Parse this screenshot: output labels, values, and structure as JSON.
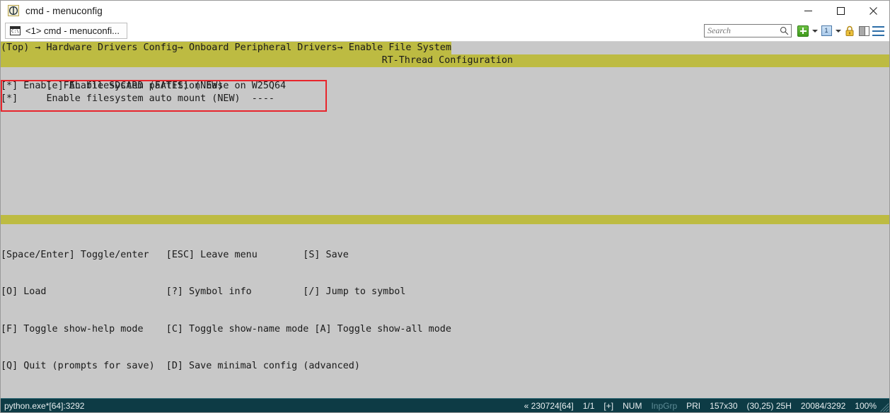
{
  "window": {
    "title": "cmd - menuconfig",
    "icon": "console-app-icon",
    "controls": {
      "minimize": "─",
      "maximize": "□",
      "close": "✕"
    }
  },
  "tabstrip": {
    "tab": {
      "label": "<1> cmd - menuconfi...",
      "icon_text": "C:\\."
    },
    "toolbar": {
      "search_placeholder": "Search",
      "search_value": "",
      "search_icon": "magnifier-icon",
      "new_tab_icon": "green-plus-icon",
      "new_tab_caret": "chevron-down-icon",
      "panel_icon_label": "1",
      "panel_caret": "chevron-down-icon",
      "lock_icon": "padlock-icon",
      "split_icon": "split-panel-icon",
      "menu_icon": "hamburger-menu-icon"
    }
  },
  "terminal": {
    "breadcrumb": "(Top) → Hardware Drivers Config→ Onboard Peripheral Drivers→ Enable File System",
    "config_title": "RT-Thread Configuration",
    "menu_items": [
      {
        "text": "[ ] Enable SDCARD (FATFS) (NEW)",
        "selected": true
      },
      {
        "text": "[*] Enable FAL filesystem partition base on W25Q64",
        "selected": false
      },
      {
        "text": "[*]     Enable filesystem auto mount (NEW)  ----",
        "selected": false
      }
    ],
    "annotation": {
      "name": "red-highlight-box",
      "color": "#e8252c"
    },
    "help_rows": [
      "[Space/Enter] Toggle/enter   [ESC] Leave menu        [S] Save",
      "[O] Load                     [?] Symbol info         [/] Jump to symbol",
      "[F] Toggle show-help mode    [C] Toggle show-name mode [A] Toggle show-all mode",
      "[Q] Quit (prompts for save)  [D] Save minimal config (advanced)"
    ]
  },
  "statusbar": {
    "left": "python.exe*[64]:3292",
    "items": [
      {
        "text": "« 230724[64]",
        "dim": false
      },
      {
        "text": "1/1",
        "dim": false
      },
      {
        "text": "[+]",
        "dim": false
      },
      {
        "text": "NUM",
        "dim": false
      },
      {
        "text": "InpGrp",
        "dim": true
      },
      {
        "text": "PRI",
        "dim": false
      },
      {
        "text": "157x30",
        "dim": false
      },
      {
        "text": "(30,25) 25H",
        "dim": false
      },
      {
        "text": "20084/3292",
        "dim": false
      },
      {
        "text": "100%",
        "dim": false
      }
    ]
  },
  "colors": {
    "olive": "#bdbb42",
    "terminal_bg": "#c8c8c8",
    "selection_blue": "#0b5ca3",
    "status_bg": "#0d3b45",
    "annotation_red": "#e8252c"
  }
}
